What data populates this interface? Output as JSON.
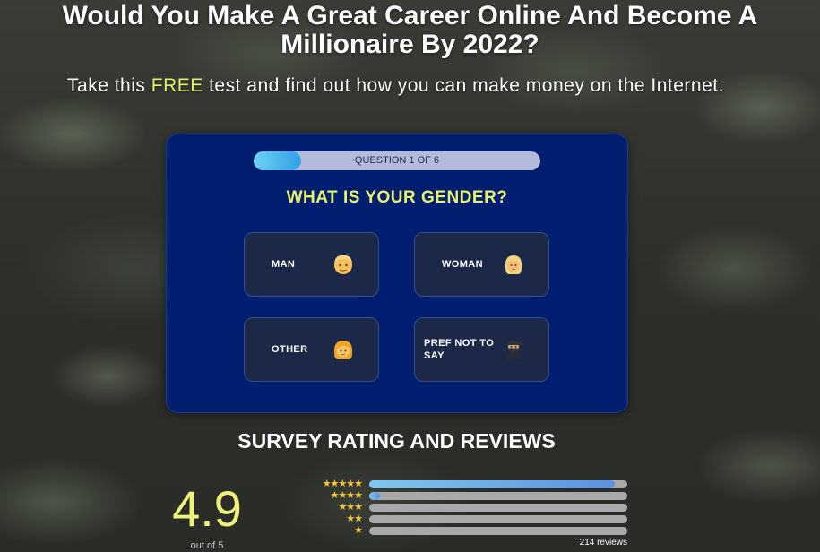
{
  "header": {
    "title": "Would You Make A Great Career Online And Become A Millionaire By 2022?",
    "subtitle_before": "Take this ",
    "subtitle_highlight": "FREE",
    "subtitle_after": " test and find out how you can make money on the Internet."
  },
  "quiz": {
    "progress_label": "QUESTION 1 OF 6",
    "progress_fraction": 0.167,
    "question": "WHAT IS YOUR GENDER?",
    "options": [
      {
        "label": "MAN",
        "icon": "man-emoji-icon"
      },
      {
        "label": "WOMAN",
        "icon": "blonde-woman-emoji-icon"
      },
      {
        "label": "OTHER",
        "icon": "person-emoji-icon"
      },
      {
        "label": "PREF NOT TO SAY",
        "icon": "ninja-emoji-icon"
      }
    ]
  },
  "reviews": {
    "title": "SURVEY RATING AND REVIEWS",
    "score": "4.9",
    "score_sub": "out of 5",
    "star_glyph": "★",
    "distribution": [
      {
        "stars": 5,
        "fraction": 0.95
      },
      {
        "stars": 4,
        "fraction": 0.04
      },
      {
        "stars": 3,
        "fraction": 0.0
      },
      {
        "stars": 2,
        "fraction": 0.0
      },
      {
        "stars": 1,
        "fraction": 0.0
      }
    ],
    "count_label": "214 reviews"
  },
  "colors": {
    "card": "#001e6f",
    "accent_yellow": "#e9f06b",
    "progress_fill": "#2fa0e6",
    "star": "#f3c93a"
  }
}
